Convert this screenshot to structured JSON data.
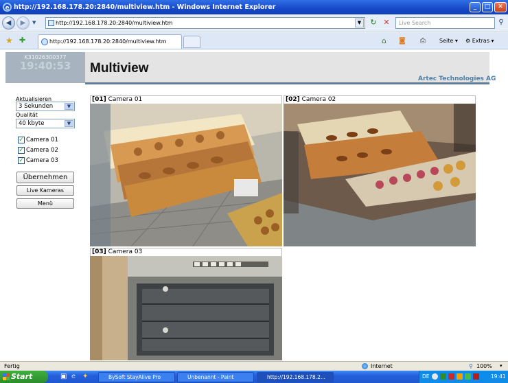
{
  "window": {
    "title": "http://192.168.178.20:2840/multiview.htm - Windows Internet Explorer"
  },
  "toolbar": {
    "address": "http://192.168.178.20:2840/multiview.htm",
    "search_placeholder": "Live Search",
    "tab_title": "http://192.168.178.20:2840/multiview.htm",
    "page_label": "Seite",
    "extras_label": "Extras"
  },
  "header": {
    "serial": "K31026300377",
    "clock": "19:40:53",
    "title": "Multiview",
    "company": "Artec Technologies AG"
  },
  "controls": {
    "refresh_label": "Aktualisieren",
    "refresh_value": "3 Sekunden",
    "quality_label": "Qualität",
    "quality_value": "40 kbyte",
    "cameras": [
      {
        "label": "Camera 01",
        "checked": true
      },
      {
        "label": "Camera 02",
        "checked": true
      },
      {
        "label": "Camera 03",
        "checked": true
      }
    ],
    "apply_button": "Übernehmen",
    "live_button": "Live Kameras",
    "menu_button": "Menü"
  },
  "views": [
    {
      "id": "[01]",
      "name": "Camera 01"
    },
    {
      "id": "[02]",
      "name": "Camera 02"
    },
    {
      "id": "[03]",
      "name": "Camera 03"
    }
  ],
  "status": {
    "left": "Fertig",
    "zone": "Internet",
    "zoom": "100%"
  },
  "taskbar": {
    "start": "Start",
    "tasks": [
      "BySoft StayAlive Pro",
      "Unbenannt - Paint",
      "http://192.168.178.2..."
    ],
    "lang": "DE",
    "time": "19:41"
  },
  "colors": {
    "titlebar": "#1f5fe0",
    "header_bg": "#e4e4e4",
    "clock_bg": "#a7b4bf",
    "company_text": "#4f7fa7",
    "taskbar": "#245edb"
  }
}
